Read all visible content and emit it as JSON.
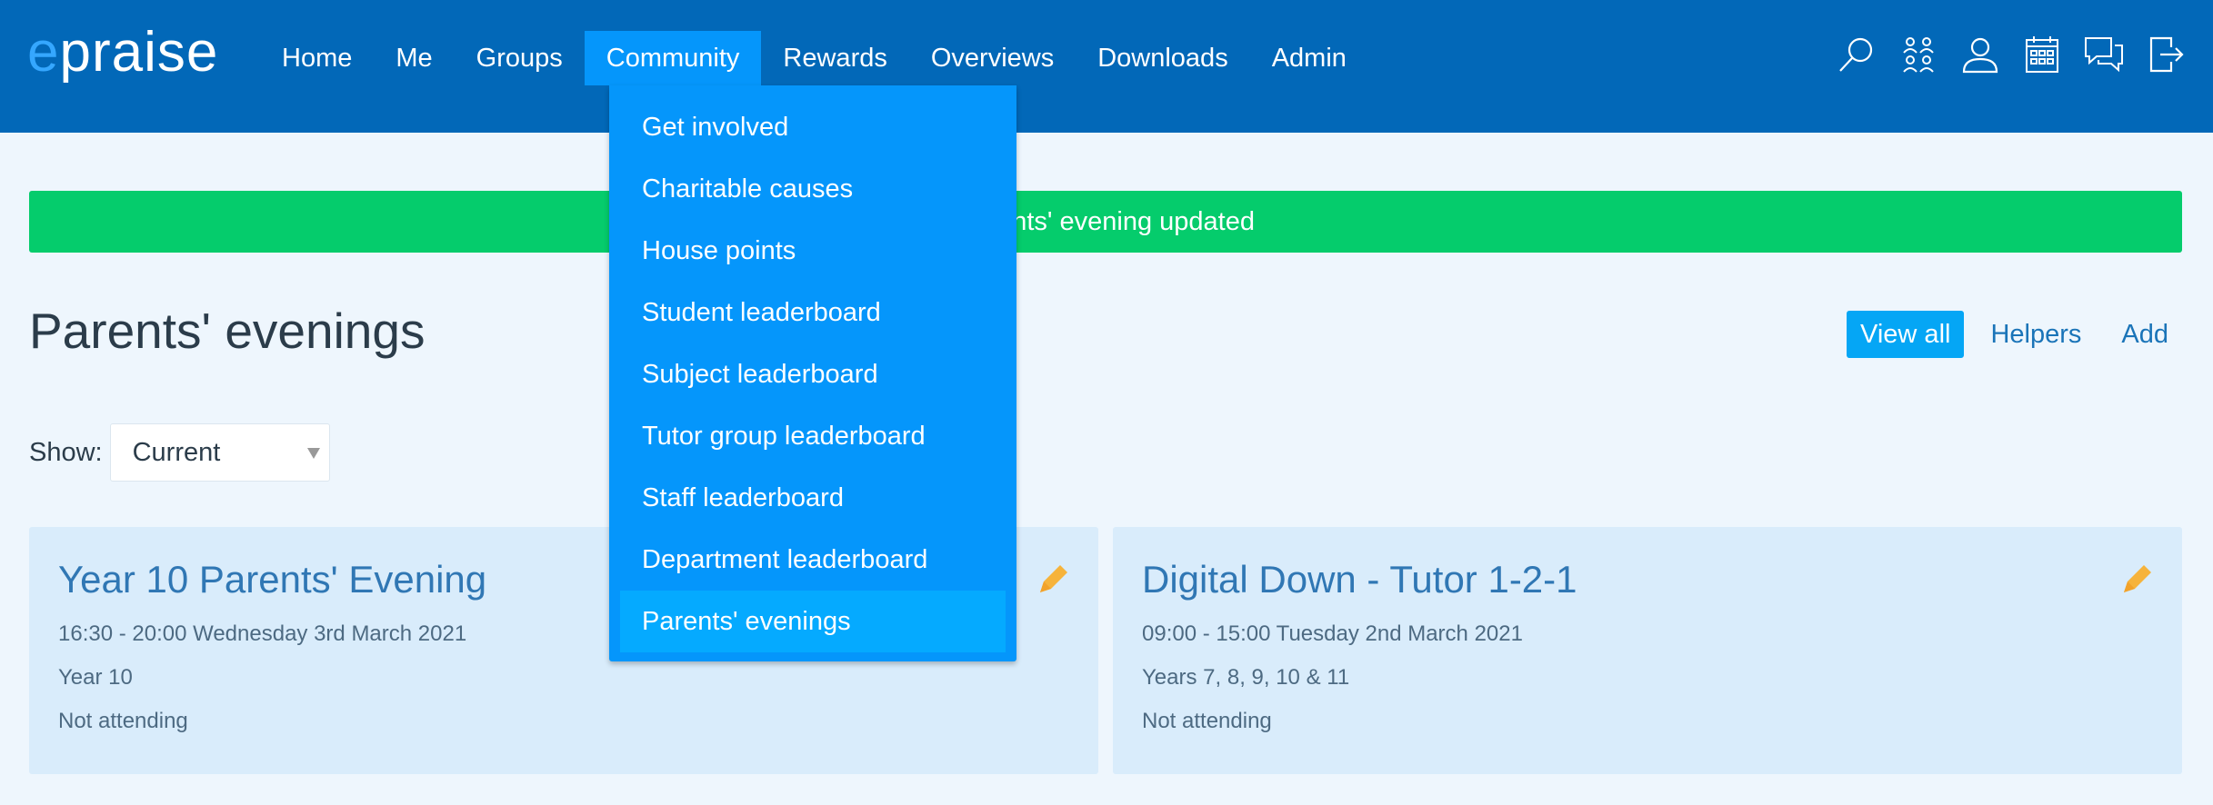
{
  "logo": {
    "e": "e",
    "rest": "praise"
  },
  "nav": {
    "items": [
      {
        "label": "Home"
      },
      {
        "label": "Me"
      },
      {
        "label": "Groups"
      },
      {
        "label": "Community"
      },
      {
        "label": "Rewards"
      },
      {
        "label": "Overviews"
      },
      {
        "label": "Downloads"
      },
      {
        "label": "Admin"
      }
    ],
    "active": "Community"
  },
  "header_icons": [
    "search-icon",
    "groups-icon",
    "user-icon",
    "calendar-icon",
    "messages-icon",
    "logout-icon"
  ],
  "dropdown": {
    "items": [
      {
        "label": "Get involved"
      },
      {
        "label": "Charitable causes"
      },
      {
        "label": "House points"
      },
      {
        "label": "Student leaderboard"
      },
      {
        "label": "Subject leaderboard"
      },
      {
        "label": "Tutor group leaderboard"
      },
      {
        "label": "Staff leaderboard"
      },
      {
        "label": "Department leaderboard"
      },
      {
        "label": "Parents' evenings"
      }
    ],
    "active": "Parents' evenings"
  },
  "alert": {
    "text": "Parents' evening updated"
  },
  "page": {
    "title": "Parents' evenings"
  },
  "actions": {
    "view_all": "View all",
    "helpers": "Helpers",
    "add": "Add"
  },
  "filter": {
    "label": "Show:",
    "value": "Current"
  },
  "cards": [
    {
      "title": "Year 10 Parents' Evening",
      "time": "16:30 - 20:00 Wednesday 3rd March 2021",
      "group": "Year 10",
      "status": "Not attending"
    },
    {
      "title": "Digital Down - Tutor 1-2-1",
      "time": "09:00 - 15:00 Tuesday 2nd March 2021",
      "group": "Years 7, 8, 9, 10 & 11",
      "status": "Not attending"
    }
  ],
  "colors": {
    "header": "#0268b8",
    "menu": "#0596fb",
    "success": "#05cc6c",
    "card": "#d9ecfb",
    "edit_icon": "#f6b33b"
  }
}
